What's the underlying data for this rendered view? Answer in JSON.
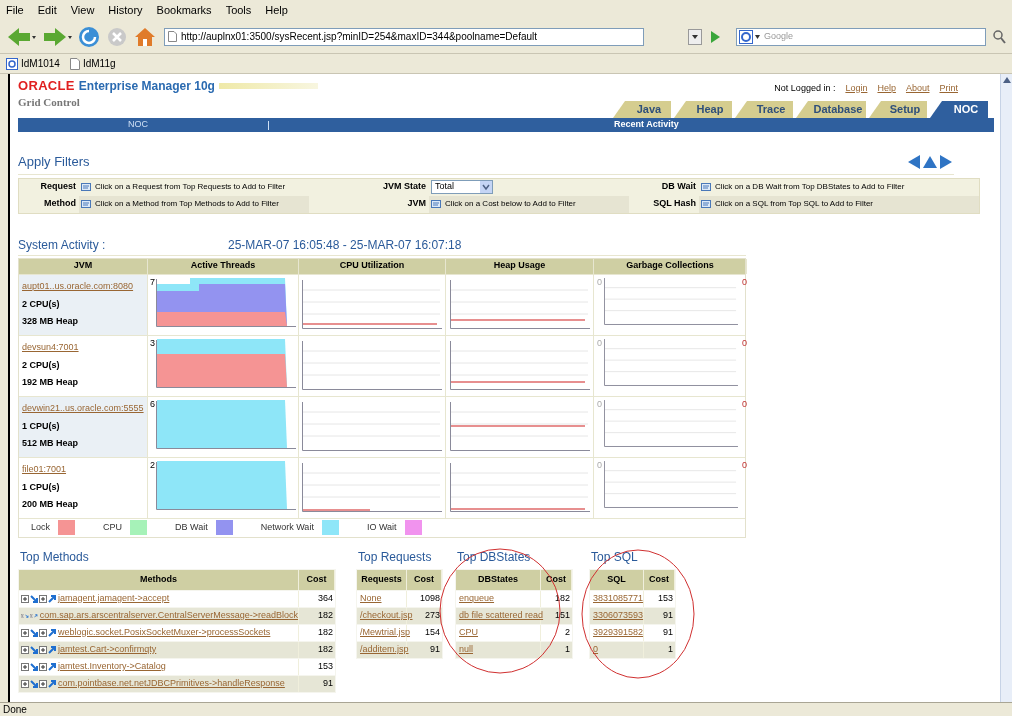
{
  "browser": {
    "menu": [
      "File",
      "Edit",
      "View",
      "History",
      "Bookmarks",
      "Tools",
      "Help"
    ],
    "url": "http://auplnx01:3500/sysRecent.jsp?minID=254&maxID=344&poolname=Default",
    "search_placeholder": "Google",
    "bookmarks": [
      "IdM1014",
      "IdM11g"
    ],
    "status": "Done"
  },
  "header": {
    "brand": "ORACLE",
    "product": "Enterprise Manager 10g",
    "subtitle": "Grid Control",
    "login_label": "Not Logged in :",
    "links": [
      "Login",
      "Help",
      "About",
      "Print"
    ],
    "tabs": [
      {
        "label": "Java",
        "selected": false
      },
      {
        "label": "Heap",
        "selected": false
      },
      {
        "label": "Trace",
        "selected": false
      },
      {
        "label": "Database",
        "selected": false
      },
      {
        "label": "Setup",
        "selected": false
      },
      {
        "label": "NOC",
        "selected": true
      }
    ],
    "bar_left": "NOC",
    "bar_right": "Recent Activity"
  },
  "filters": {
    "title": "Apply Filters",
    "rows": [
      [
        {
          "kind": "hint",
          "label": "Request",
          "text": "Click on a Request from Top Requests to Add to Filter"
        },
        {
          "kind": "select",
          "label": "JVM State",
          "value": "Total"
        },
        {
          "kind": "hint",
          "label": "DB Wait",
          "text": "Click on a DB Wait from Top DBStates to Add to Filter"
        }
      ],
      [
        {
          "kind": "hint",
          "label": "Method",
          "text": "Click on a Method from Top Methods to Add to Filter"
        },
        {
          "kind": "hint",
          "label": "JVM",
          "text": "Click on a Cost below to Add to Filter"
        },
        {
          "kind": "hint",
          "label": "SQL Hash",
          "text": "Click on a SQL from Top SQL to Add to Filter"
        }
      ]
    ]
  },
  "system_activity": {
    "title": "System Activity :",
    "range": "25-MAR-07 16:05:48 - 25-MAR-07 16:07:18",
    "columns": [
      "JVM",
      "Active Threads",
      "CPU Utilization",
      "Heap Usage",
      "Garbage Collections"
    ],
    "rows": [
      {
        "jvm": "aupt01..us.oracle.com:8080",
        "cpus": "2 CPU(s)",
        "heap": "328 MB Heap",
        "threads_max": "7",
        "gc_min": "0",
        "gc_max": "0"
      },
      {
        "jvm": "devsun4:7001",
        "cpus": "2 CPU(s)",
        "heap": "192 MB Heap",
        "threads_max": "3",
        "gc_min": "0",
        "gc_max": "0"
      },
      {
        "jvm": "devwin21..us.oracle.com:5555",
        "cpus": "1 CPU(s)",
        "heap": "512 MB Heap",
        "threads_max": "6",
        "gc_min": "0",
        "gc_max": "0"
      },
      {
        "jvm": "file01:7001",
        "cpus": "1 CPU(s)",
        "heap": "200 MB Heap",
        "threads_max": "2",
        "gc_min": "0",
        "gc_max": "0"
      }
    ],
    "legend": [
      {
        "label": "Lock",
        "color": "#f59494"
      },
      {
        "label": "CPU",
        "color": "#a6f2b8"
      },
      {
        "label": "DB Wait",
        "color": "#9393f0"
      },
      {
        "label": "Network Wait",
        "color": "#8ee6f8"
      },
      {
        "label": "IO Wait",
        "color": "#f193ee"
      }
    ]
  },
  "top_methods": {
    "title": "Top Methods",
    "columns": [
      "Methods",
      "Cost"
    ],
    "rows": [
      [
        "jamagent.jamagent->accept",
        "364"
      ],
      [
        "com.sap.ars.arscentralserver.CentralServerMessage->readBlock",
        "182"
      ],
      [
        "weblogic.socket.PosixSocketMuxer->processSockets",
        "182"
      ],
      [
        "jamtest.Cart->confirmqty",
        "182"
      ],
      [
        "jamtest.Inventory->Catalog",
        "153"
      ],
      [
        "com.pointbase.net.netJDBCPrimitives->handleResponse",
        "91"
      ]
    ]
  },
  "top_requests": {
    "title": "Top Requests",
    "columns": [
      "Requests",
      "Cost"
    ],
    "rows": [
      [
        "None",
        "1098"
      ],
      [
        "/checkout.jsp",
        "273"
      ],
      [
        "/Mewtrial.jsp",
        "154"
      ],
      [
        "/additem.jsp",
        "91"
      ]
    ]
  },
  "top_dbstates": {
    "title": "Top DBStates",
    "columns": [
      "DBStates",
      "Cost"
    ],
    "rows": [
      [
        "enqueue",
        "182"
      ],
      [
        "db file scattered read",
        "151"
      ],
      [
        "CPU",
        "2"
      ],
      [
        "null",
        "1"
      ]
    ]
  },
  "top_sql": {
    "title": "Top SQL",
    "columns": [
      "SQL",
      "Cost"
    ],
    "rows": [
      [
        "3831085771",
        "153"
      ],
      [
        "3306073593",
        "91"
      ],
      [
        "3929391582",
        "91"
      ],
      [
        "0",
        "1"
      ]
    ]
  }
}
